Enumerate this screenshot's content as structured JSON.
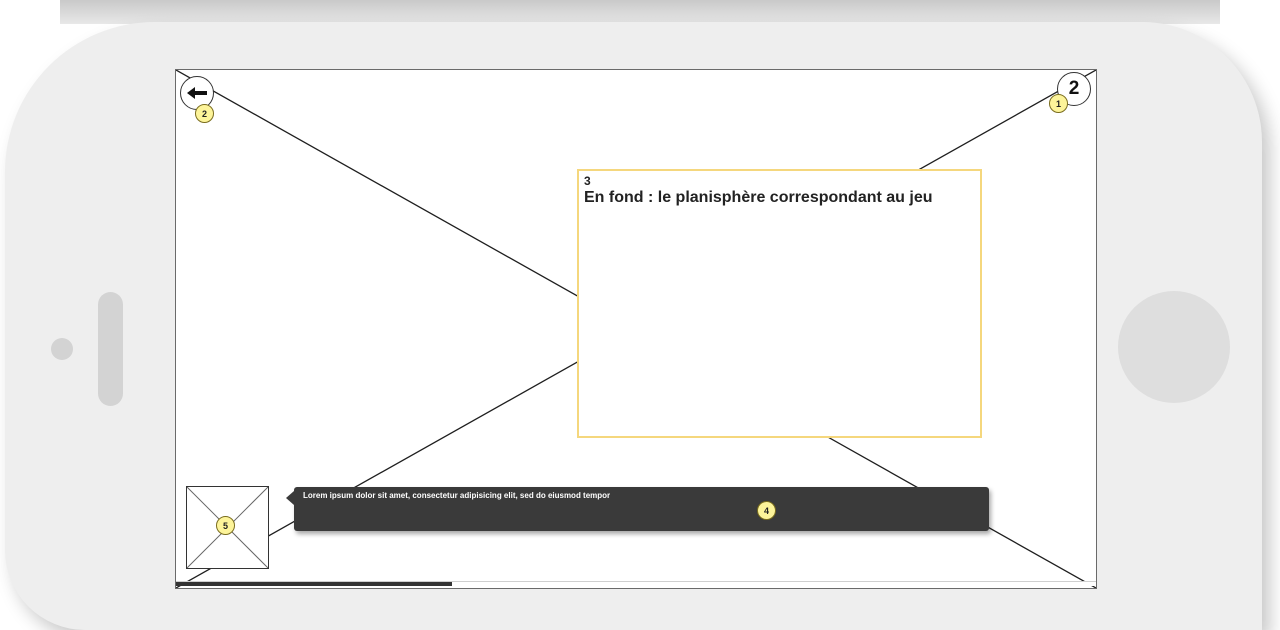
{
  "screen": {
    "back_button": {
      "icon": "arrow-left-icon"
    },
    "page_button": {
      "label": "2"
    },
    "annotations": {
      "page_button": "1",
      "back_button": "2",
      "text_box": "3",
      "speech_bubble": "4",
      "thumbnail": "5"
    },
    "note": {
      "number": "3",
      "text": "En fond : le planisphère correspondant au jeu"
    },
    "speech_bubble": {
      "text": "Lorem ipsum dolor sit amet, consectetur adipisicing elit, sed do eiusmod tempor"
    },
    "progress": {
      "value": 0.3
    }
  },
  "colors": {
    "device_body": "#eeeeee",
    "annotation_badge": "#fdf49a",
    "note_border": "#f5d77d",
    "speech_bubble": "#3a3a3a",
    "progress_fill": "#333333"
  }
}
